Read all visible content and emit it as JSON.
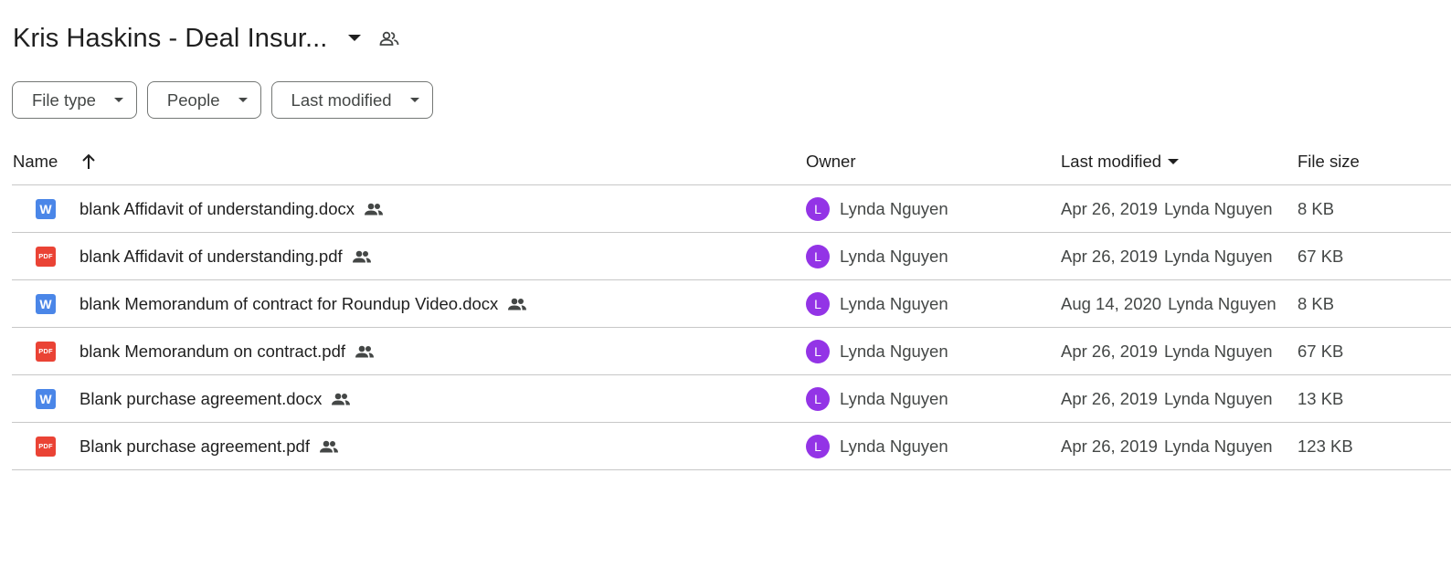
{
  "folder": {
    "title": "Kris Haskins - Deal Insur...",
    "caret_icon": "arrow-drop-down-icon",
    "shared_icon": "people-outline-icon"
  },
  "filters": [
    {
      "label": "File type"
    },
    {
      "label": "People"
    },
    {
      "label": "Last modified"
    }
  ],
  "columns": {
    "name": "Name",
    "owner": "Owner",
    "last_modified": "Last modified",
    "file_size": "File size",
    "sort": "Name ascending",
    "modified_sort": "descending"
  },
  "colors": {
    "avatar": "#9334e6",
    "docx_icon": "#4a86e8",
    "pdf_icon": "#ea4335",
    "divider": "#c7c7c7"
  },
  "files": [
    {
      "type": "docx",
      "type_label": "W",
      "name": "blank Affidavit of understanding.docx",
      "shared": true,
      "owner_initial": "L",
      "owner": "Lynda Nguyen",
      "modified_date": "Apr 26, 2019",
      "modified_by": "Lynda Nguyen",
      "size": "8 KB"
    },
    {
      "type": "pdf",
      "type_label": "PDF",
      "name": "blank Affidavit of understanding.pdf",
      "shared": true,
      "owner_initial": "L",
      "owner": "Lynda Nguyen",
      "modified_date": "Apr 26, 2019",
      "modified_by": "Lynda Nguyen",
      "size": "67 KB"
    },
    {
      "type": "docx",
      "type_label": "W",
      "name": "blank Memorandum of contract for Roundup Video.docx",
      "shared": true,
      "owner_initial": "L",
      "owner": "Lynda Nguyen",
      "modified_date": "Aug 14, 2020",
      "modified_by": "Lynda Nguyen",
      "size": "8 KB"
    },
    {
      "type": "pdf",
      "type_label": "PDF",
      "name": "blank Memorandum on contract.pdf",
      "shared": true,
      "owner_initial": "L",
      "owner": "Lynda Nguyen",
      "modified_date": "Apr 26, 2019",
      "modified_by": "Lynda Nguyen",
      "size": "67 KB"
    },
    {
      "type": "docx",
      "type_label": "W",
      "name": "Blank purchase agreement.docx",
      "shared": true,
      "owner_initial": "L",
      "owner": "Lynda Nguyen",
      "modified_date": "Apr 26, 2019",
      "modified_by": "Lynda Nguyen",
      "size": "13 KB"
    },
    {
      "type": "pdf",
      "type_label": "PDF",
      "name": "Blank purchase agreement.pdf",
      "shared": true,
      "owner_initial": "L",
      "owner": "Lynda Nguyen",
      "modified_date": "Apr 26, 2019",
      "modified_by": "Lynda Nguyen",
      "size": "123 KB"
    }
  ]
}
